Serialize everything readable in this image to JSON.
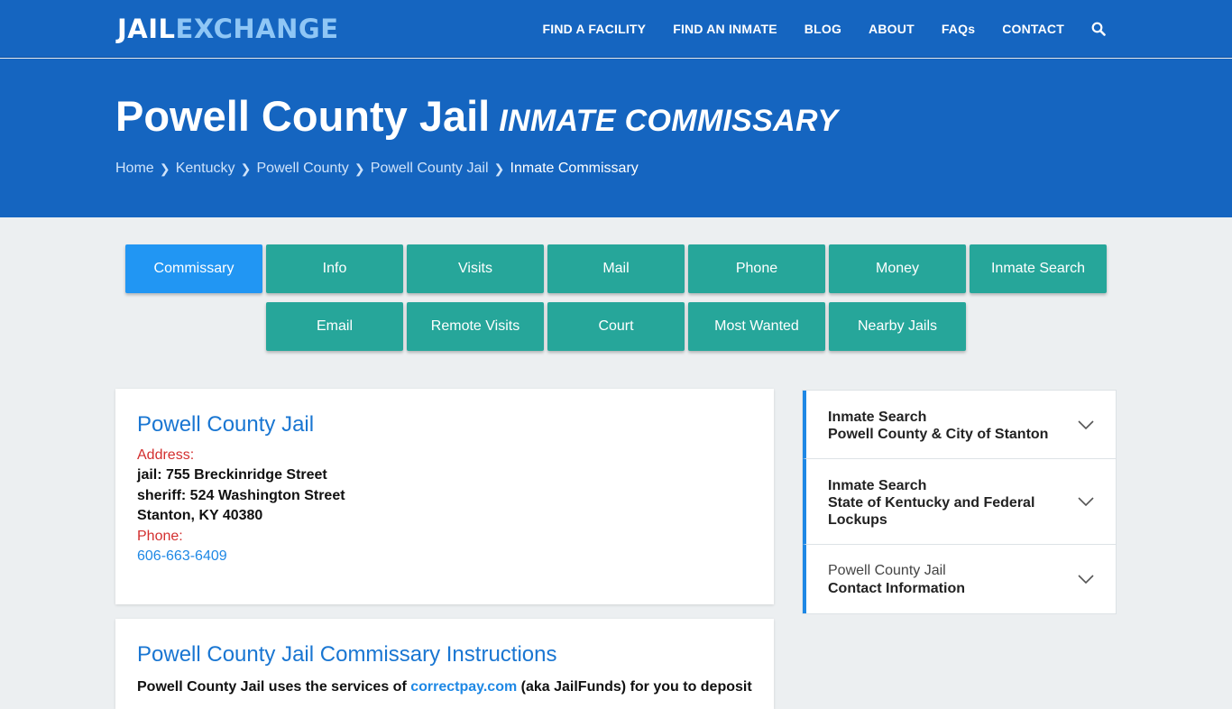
{
  "logo": {
    "part1": "JAIL",
    "part2": "EXCHANGE"
  },
  "nav": [
    {
      "label": "FIND A FACILITY"
    },
    {
      "label": "FIND AN INMATE"
    },
    {
      "label": "BLOG"
    },
    {
      "label": "ABOUT"
    },
    {
      "label": "FAQs"
    },
    {
      "label": "CONTACT"
    }
  ],
  "hero": {
    "title": "Powell County Jail",
    "subtitle": "INMATE COMMISSARY",
    "breadcrumbs": [
      "Home",
      "Kentucky",
      "Powell County",
      "Powell County Jail"
    ],
    "current": "Inmate Commissary"
  },
  "tabs": {
    "row1": [
      "Commissary",
      "Info",
      "Visits",
      "Mail",
      "Phone",
      "Money",
      "Inmate Search"
    ],
    "row2": [
      "Email",
      "Remote Visits",
      "Court",
      "Most Wanted",
      "Nearby Jails"
    ],
    "active": "Commissary"
  },
  "facility": {
    "name": "Powell County Jail",
    "address_label": "Address:",
    "address_lines": [
      "jail: 755 Breckinridge Street",
      "sheriff: 524 Washington Street",
      "Stanton, KY 40380"
    ],
    "phone_label": "Phone:",
    "phone": "606-663-6409"
  },
  "instructions": {
    "title": "Powell County Jail Commissary Instructions",
    "text_before": "Powell County Jail uses the services of ",
    "link": "correctpay.com",
    "text_after": " (aka JailFunds) for you to deposit"
  },
  "sidebar": [
    {
      "line1": "Inmate Search",
      "line2": "Powell County & City of Stanton",
      "line3": ""
    },
    {
      "line1": "Inmate Search",
      "line2": "State of Kentucky and Federal",
      "line3": "Lockups"
    },
    {
      "line1": "Powell County Jail",
      "line2": "Contact Information",
      "line3": ""
    }
  ],
  "colors": {
    "primary": "#1565c0",
    "tab": "#26a69a",
    "tab_active": "#2196f3",
    "link": "#1e88e5",
    "label": "#d32f2f"
  }
}
